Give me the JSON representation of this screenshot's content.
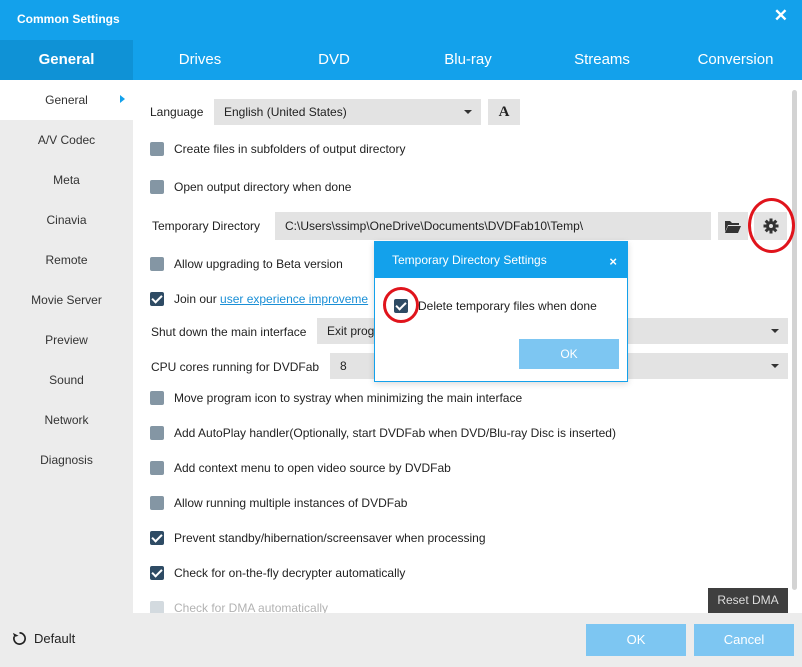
{
  "window": {
    "title": "Common Settings"
  },
  "tabs": [
    {
      "label": "General"
    },
    {
      "label": "Drives"
    },
    {
      "label": "DVD"
    },
    {
      "label": "Blu-ray"
    },
    {
      "label": "Streams"
    },
    {
      "label": "Conversion"
    }
  ],
  "sidebar": {
    "items": [
      {
        "label": "General"
      },
      {
        "label": "A/V Codec"
      },
      {
        "label": "Meta"
      },
      {
        "label": "Cinavia"
      },
      {
        "label": "Remote"
      },
      {
        "label": "Movie Server"
      },
      {
        "label": "Preview"
      },
      {
        "label": "Sound"
      },
      {
        "label": "Network"
      },
      {
        "label": "Diagnosis"
      }
    ]
  },
  "settings": {
    "language": {
      "label": "Language",
      "value": "English (United States)",
      "font_button": "A"
    },
    "create_subfolders": {
      "label": "Create files in subfolders of output directory",
      "checked": false
    },
    "open_output_dir": {
      "label": "Open output directory when done",
      "checked": false
    },
    "temp_dir": {
      "label": "Temporary Directory",
      "value": "C:\\Users\\ssimp\\OneDrive\\Documents\\DVDFab10\\Temp\\"
    },
    "allow_beta": {
      "label": "Allow upgrading to Beta version",
      "checked": false
    },
    "join_ux": {
      "prefix": "Join our ",
      "link": "user experience improveme",
      "checked": true
    },
    "shutdown": {
      "label": "Shut down the main interface",
      "value": "Exit prog"
    },
    "cpu_cores": {
      "label": "CPU cores running for DVDFab",
      "value": "8"
    },
    "systray": {
      "label": "Move program icon to systray when minimizing the main interface",
      "checked": false
    },
    "autoplay": {
      "label": "Add AutoPlay handler(Optionally, start DVDFab when DVD/Blu-ray Disc is inserted)",
      "checked": false
    },
    "context_menu": {
      "label": "Add context menu to open video source by DVDFab",
      "checked": false
    },
    "multi_instance": {
      "label": "Allow running multiple instances of DVDFab",
      "checked": false
    },
    "prevent_standby": {
      "label": "Prevent standby/hibernation/screensaver when processing",
      "checked": true
    },
    "decrypter": {
      "label": "Check for on-the-fly decrypter automatically",
      "checked": true
    },
    "dma": {
      "label": "Check for DMA automatically",
      "checked": false
    },
    "reset_dma": "Reset DMA"
  },
  "footer": {
    "default_label": "Default",
    "ok_label": "OK",
    "cancel_label": "Cancel"
  },
  "popup": {
    "title": "Temporary Directory Settings",
    "close": "×",
    "option": {
      "label": "Delete temporary files when done",
      "checked": true
    },
    "ok_label": "OK"
  },
  "colors": {
    "accent": "#13a1eb",
    "button": "#7dc6f2",
    "highlight_ring": "#e0141c"
  },
  "icons": [
    "close-icon",
    "folder-icon",
    "gear-icon",
    "reset-icon",
    "chevron-right-icon",
    "chevron-down-icon"
  ]
}
